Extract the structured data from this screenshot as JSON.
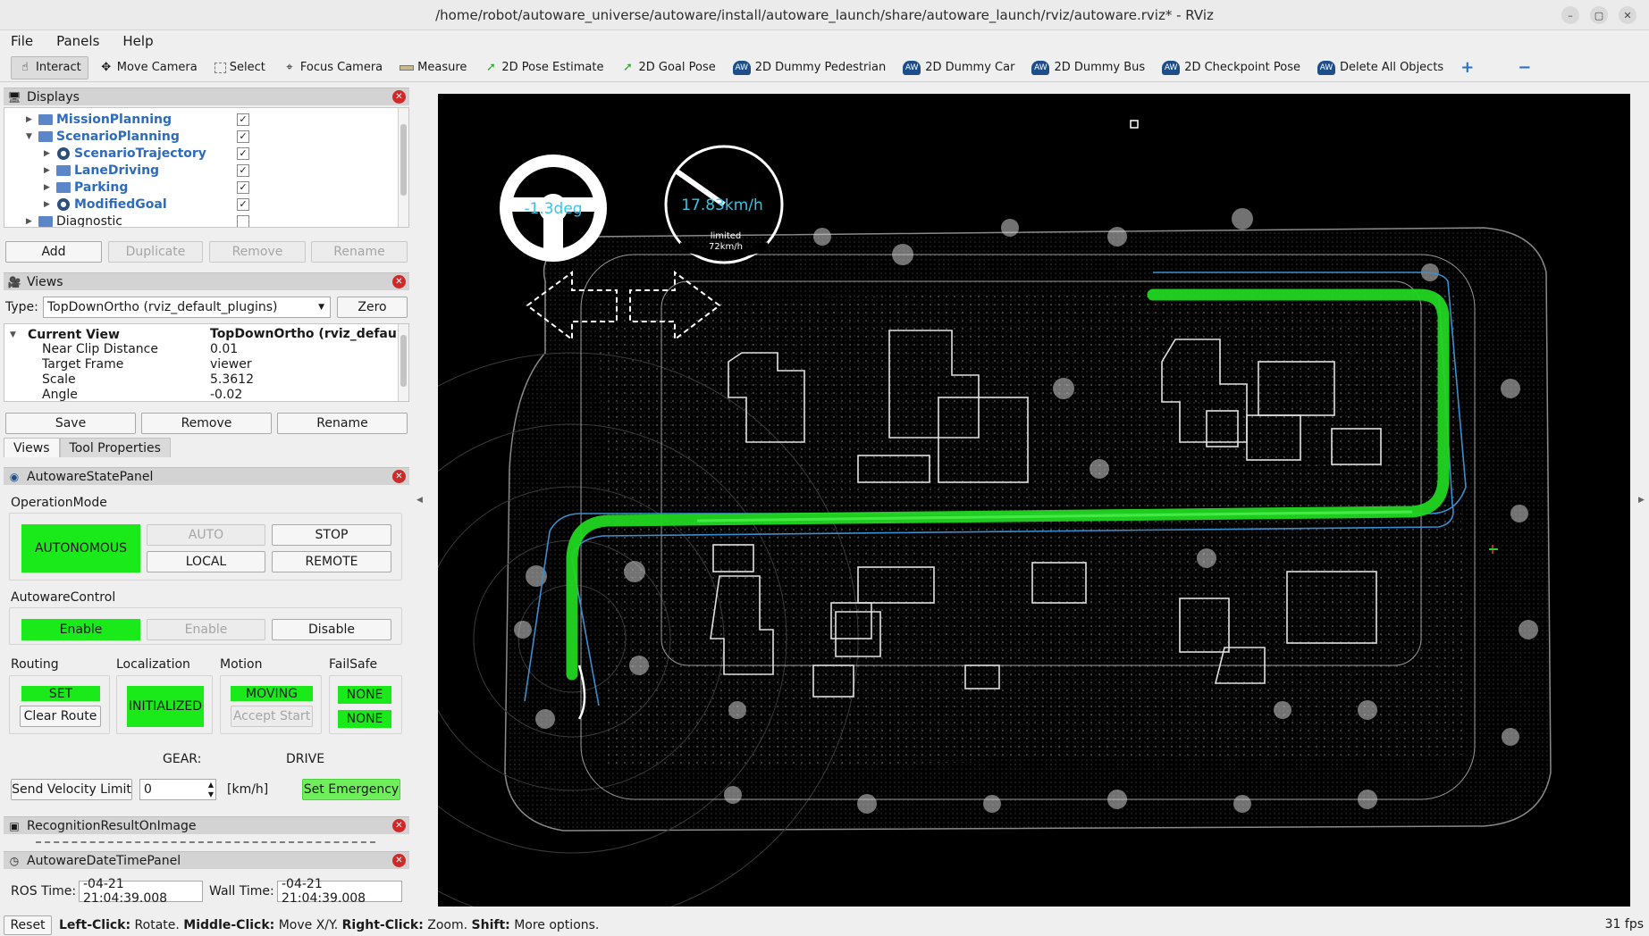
{
  "window": {
    "title": "/home/robot/autoware_universe/autoware/install/autoware_launch/share/autoware_launch/rviz/autoware.rviz* - RViz"
  },
  "menu": [
    "File",
    "Panels",
    "Help"
  ],
  "toolbar": {
    "tools": [
      {
        "label": "Interact",
        "icon": "cursor-icon"
      },
      {
        "label": "Move Camera",
        "icon": "move-camera-icon"
      },
      {
        "label": "Select",
        "icon": "select-icon"
      },
      {
        "label": "Focus Camera",
        "icon": "focus-camera-icon"
      },
      {
        "label": "Measure",
        "icon": "ruler-icon"
      },
      {
        "label": "2D Pose Estimate",
        "icon": "green-arrow-icon"
      },
      {
        "label": "2D Goal Pose",
        "icon": "green-arrow-icon"
      },
      {
        "label": "2D Dummy Pedestrian",
        "icon": "autoware-logo-icon"
      },
      {
        "label": "2D Dummy Car",
        "icon": "autoware-logo-icon"
      },
      {
        "label": "2D Dummy Bus",
        "icon": "autoware-logo-icon"
      },
      {
        "label": "2D Checkpoint Pose",
        "icon": "autoware-logo-icon"
      },
      {
        "label": "Delete All Objects",
        "icon": "autoware-logo-icon"
      }
    ],
    "add_tool": "+",
    "remove_tool": "−"
  },
  "displays": {
    "title": "Displays",
    "items": [
      {
        "label": "MissionPlanning",
        "checked": true
      },
      {
        "label": "ScenarioPlanning",
        "checked": true
      },
      {
        "label": "ScenarioTrajectory",
        "checked": true
      },
      {
        "label": "LaneDriving",
        "checked": true
      },
      {
        "label": "Parking",
        "checked": true
      },
      {
        "label": "ModifiedGoal",
        "checked": true
      },
      {
        "label": "Diagnostic",
        "checked": false
      }
    ],
    "buttons": {
      "add": "Add",
      "duplicate": "Duplicate",
      "remove": "Remove",
      "rename": "Rename"
    }
  },
  "views": {
    "title": "Views",
    "type_label": "Type:",
    "type_value": "TopDownOrtho (rviz_default_plugins)",
    "zero": "Zero",
    "current_view": "Current View",
    "current_view_value": "TopDownOrtho (rviz_default...",
    "properties": [
      {
        "name": "Near Clip Distance",
        "value": "0.01"
      },
      {
        "name": "Target Frame",
        "value": "viewer"
      },
      {
        "name": "Scale",
        "value": "5.3612"
      },
      {
        "name": "Angle",
        "value": "-0.02"
      }
    ],
    "buttons": {
      "save": "Save",
      "remove": "Remove",
      "rename": "Rename"
    },
    "tabs": [
      "Views",
      "Tool Properties"
    ]
  },
  "state_panel": {
    "title": "AutowareStatePanel",
    "operation_mode_label": "OperationMode",
    "autonomous": "AUTONOMOUS",
    "auto": "AUTO",
    "stop": "STOP",
    "local": "LOCAL",
    "remote": "REMOTE",
    "control_label": "AutowareControl",
    "enable_active": "Enable",
    "enable_disabled": "Enable",
    "disable": "Disable",
    "routing_label": "Routing",
    "routing_state": "SET",
    "clear_route": "Clear Route",
    "localization_label": "Localization",
    "localization_state": "INITIALIZED",
    "motion_label": "Motion",
    "motion_state": "MOVING",
    "accept_start": "Accept Start",
    "failsafe_label": "FailSafe",
    "failsafe_state_1": "NONE",
    "failsafe_state_2": "NONE",
    "gear_label": "GEAR:",
    "gear_value": "DRIVE",
    "send_velocity_limit": "Send Velocity Limit",
    "velocity_value": "0",
    "velocity_unit": "[km/h]",
    "set_emergency": "Set Emergency"
  },
  "recognition_panel": {
    "title": "RecognitionResultOnImage"
  },
  "datetime_panel": {
    "title": "AutowareDateTimePanel",
    "ros_time_label": "ROS Time:",
    "ros_time_value": "-04-21 21:04:39.008",
    "wall_time_label": "Wall Time:",
    "wall_time_value": "-04-21 21:04:39.008"
  },
  "viewport": {
    "steering_text": "-1.3deg",
    "speed_text": "17.83km/h",
    "limit_text": "limited",
    "limit_value": "72km/h",
    "path_color": "#22d622",
    "lane_color": "#3a8fd0"
  },
  "statusbar": {
    "reset": "Reset",
    "left_click": "Left-Click:",
    "left_action": "Rotate.",
    "middle_click": "Middle-Click:",
    "middle_action": "Move X/Y.",
    "right_click": "Right-Click:",
    "right_action": "Zoom.",
    "shift": "Shift:",
    "shift_action": "More options.",
    "fps": "31 fps"
  },
  "colors": {
    "status_green": "#1aea1a",
    "panel_header": "#d3d3d3",
    "close_red": "#d02929",
    "tree_blue_text": "#2e6bbd"
  }
}
